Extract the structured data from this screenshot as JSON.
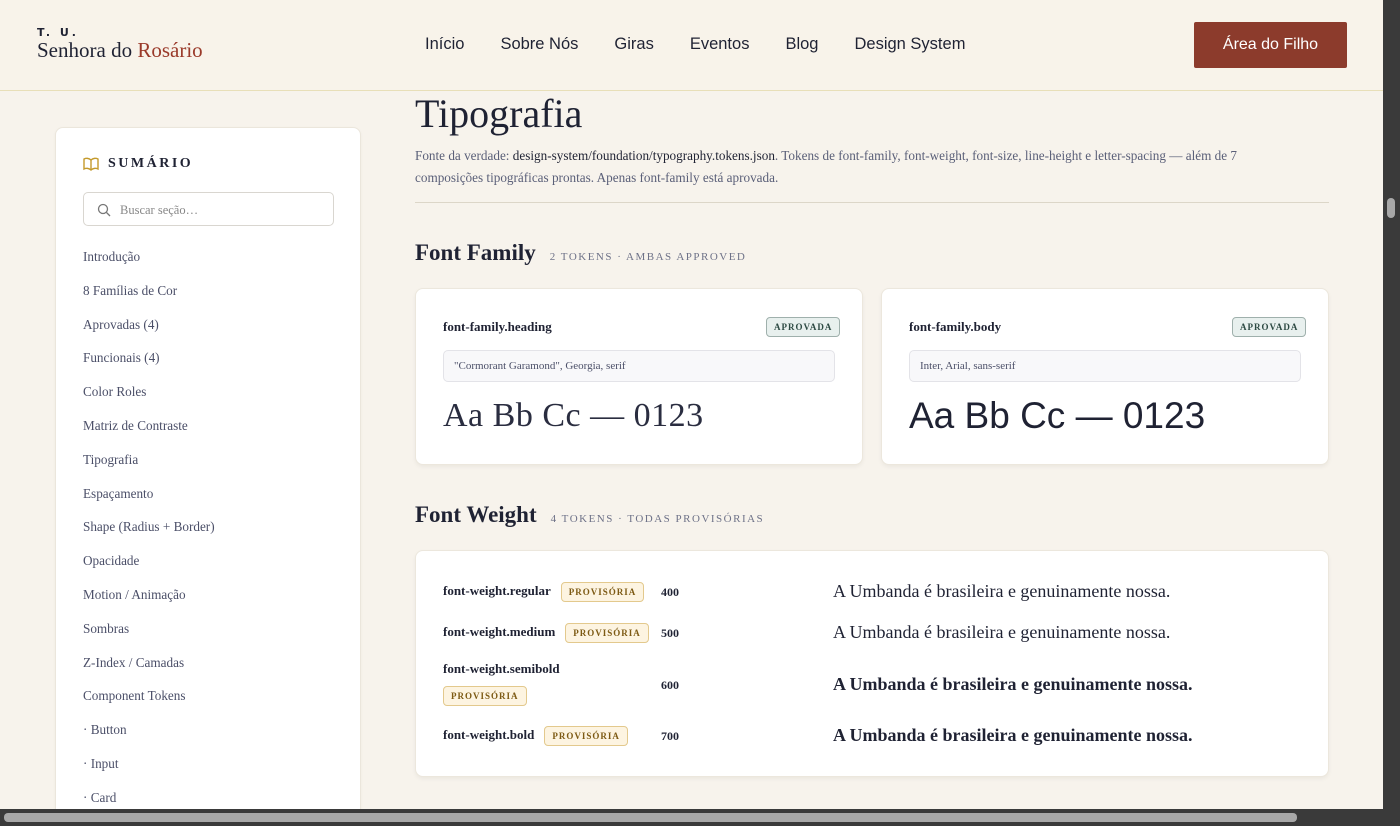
{
  "header": {
    "logo_top": "T. U.",
    "logo_main": "Senhora do ",
    "logo_accent": "Rosário",
    "nav": [
      "Início",
      "Sobre Nós",
      "Giras",
      "Eventos",
      "Blog",
      "Design System"
    ],
    "cta_label": "Área do Filho"
  },
  "sidebar": {
    "title": "SUMÁRIO",
    "search_placeholder": "Buscar seção…",
    "items": [
      "Introdução",
      "8 Famílias de Cor",
      "Aprovadas (4)",
      "Funcionais (4)",
      "Color Roles",
      "Matriz de Contraste",
      "Tipografia",
      "Espaçamento",
      "Shape (Radius + Border)",
      "Opacidade",
      "Motion / Animação",
      "Sombras",
      "Z-Index / Camadas",
      "Component Tokens",
      "· Button",
      "· Input",
      "· Card"
    ]
  },
  "main": {
    "title": "Tipografia",
    "intro_prefix": "Fonte da verdade: ",
    "intro_path": "design-system/foundation/typography.tokens.json",
    "intro_mid": ". Tokens de ",
    "intro_tokens": "font-family, font-weight, font-size, line-height e letter-spacing",
    "intro_suffix": " — além de 7 composições tipográficas prontas. Apenas font-family está aprovada.",
    "font_family": {
      "title": "Font Family",
      "meta": "2 TOKENS · AMBAS APPROVED",
      "cards": [
        {
          "name": "font-family.heading",
          "badge": "APROVADA",
          "value": "\"Cormorant Garamond\", Georgia, serif",
          "sample": "Aa Bb Cc — 0123"
        },
        {
          "name": "font-family.body",
          "badge": "APROVADA",
          "value": "Inter, Arial, sans-serif",
          "sample": "Aa Bb Cc — 0123"
        }
      ]
    },
    "font_weight": {
      "title": "Font Weight",
      "meta": "4 TOKENS · TODAS PROVISÓRIAS",
      "rows": [
        {
          "name": "font-weight.regular",
          "badge": "PROVISÓRIA",
          "value": "400",
          "sample": "A Umbanda é brasileira e genuinamente nossa."
        },
        {
          "name": "font-weight.medium",
          "badge": "PROVISÓRIA",
          "value": "500",
          "sample": "A Umbanda é brasileira e genuinamente nossa."
        },
        {
          "name": "font-weight.semibold",
          "badge": "PROVISÓRIA",
          "value": "600",
          "sample": "A Umbanda é brasileira e genuinamente nossa."
        },
        {
          "name": "font-weight.bold",
          "badge": "PROVISÓRIA",
          "value": "700",
          "sample": "A Umbanda é brasileira e genuinamente nossa."
        }
      ]
    }
  },
  "colors": {
    "brand": "#8c3b2c",
    "accent_gold": "#c49a2c",
    "background": "#f7f3ec"
  }
}
